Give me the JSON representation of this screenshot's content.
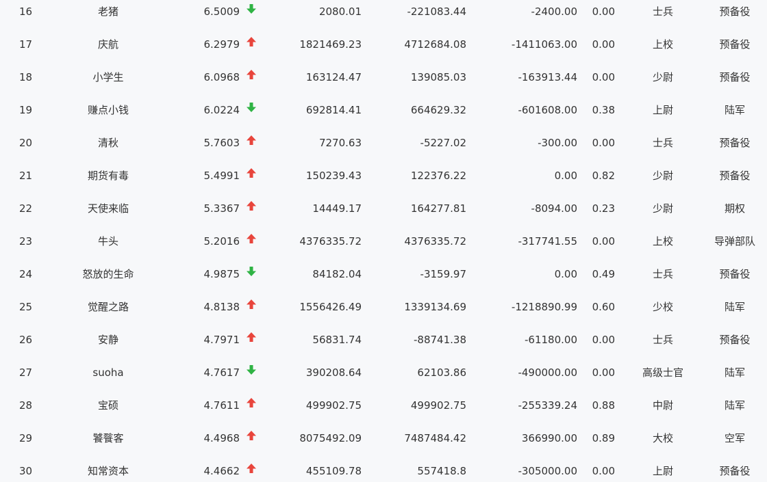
{
  "colors": {
    "background": "#f7f8fa",
    "text": "#333333",
    "up": "#e8453c",
    "down": "#2fb344"
  },
  "rows": [
    {
      "rank": "16",
      "name": "老猪",
      "score": "6.5009",
      "trend": "down",
      "v1": "2080.01",
      "v2": "-221083.44",
      "v3": "-2400.00",
      "v4": "0.00",
      "title": "士兵",
      "unit": "预备役"
    },
    {
      "rank": "17",
      "name": "庆航",
      "score": "6.2979",
      "trend": "up",
      "v1": "1821469.23",
      "v2": "4712684.08",
      "v3": "-1411063.00",
      "v4": "0.00",
      "title": "上校",
      "unit": "预备役"
    },
    {
      "rank": "18",
      "name": "小学生",
      "score": "6.0968",
      "trend": "up",
      "v1": "163124.47",
      "v2": "139085.03",
      "v3": "-163913.44",
      "v4": "0.00",
      "title": "少尉",
      "unit": "预备役"
    },
    {
      "rank": "19",
      "name": "赚点小钱",
      "score": "6.0224",
      "trend": "down",
      "v1": "692814.41",
      "v2": "664629.32",
      "v3": "-601608.00",
      "v4": "0.38",
      "title": "上尉",
      "unit": "陆军"
    },
    {
      "rank": "20",
      "name": "清秋",
      "score": "5.7603",
      "trend": "up",
      "v1": "7270.63",
      "v2": "-5227.02",
      "v3": "-300.00",
      "v4": "0.00",
      "title": "士兵",
      "unit": "预备役"
    },
    {
      "rank": "21",
      "name": "期货有毒",
      "score": "5.4991",
      "trend": "up",
      "v1": "150239.43",
      "v2": "122376.22",
      "v3": "0.00",
      "v4": "0.82",
      "title": "少尉",
      "unit": "预备役"
    },
    {
      "rank": "22",
      "name": "天使来临",
      "score": "5.3367",
      "trend": "up",
      "v1": "14449.17",
      "v2": "164277.81",
      "v3": "-8094.00",
      "v4": "0.23",
      "title": "少尉",
      "unit": "期权"
    },
    {
      "rank": "23",
      "name": "牛头",
      "score": "5.2016",
      "trend": "up",
      "v1": "4376335.72",
      "v2": "4376335.72",
      "v3": "-317741.55",
      "v4": "0.00",
      "title": "上校",
      "unit": "导弹部队"
    },
    {
      "rank": "24",
      "name": "怒放的生命",
      "score": "4.9875",
      "trend": "down",
      "v1": "84182.04",
      "v2": "-3159.97",
      "v3": "0.00",
      "v4": "0.49",
      "title": "士兵",
      "unit": "预备役"
    },
    {
      "rank": "25",
      "name": "觉醒之路",
      "score": "4.8138",
      "trend": "up",
      "v1": "1556426.49",
      "v2": "1339134.69",
      "v3": "-1218890.99",
      "v4": "0.60",
      "title": "少校",
      "unit": "陆军"
    },
    {
      "rank": "26",
      "name": "安静",
      "score": "4.7971",
      "trend": "up",
      "v1": "56831.74",
      "v2": "-88741.38",
      "v3": "-61180.00",
      "v4": "0.00",
      "title": "士兵",
      "unit": "预备役"
    },
    {
      "rank": "27",
      "name": "suoha",
      "score": "4.7617",
      "trend": "down",
      "v1": "390208.64",
      "v2": "62103.86",
      "v3": "-490000.00",
      "v4": "0.00",
      "title": "高级士官",
      "unit": "陆军"
    },
    {
      "rank": "28",
      "name": "宝硕",
      "score": "4.7611",
      "trend": "up",
      "v1": "499902.75",
      "v2": "499902.75",
      "v3": "-255339.24",
      "v4": "0.88",
      "title": "中尉",
      "unit": "陆军"
    },
    {
      "rank": "29",
      "name": "饕餮客",
      "score": "4.4968",
      "trend": "up",
      "v1": "8075492.09",
      "v2": "7487484.42",
      "v3": "366990.00",
      "v4": "0.89",
      "title": "大校",
      "unit": "空军"
    },
    {
      "rank": "30",
      "name": "知常资本",
      "score": "4.4662",
      "trend": "up",
      "v1": "455109.78",
      "v2": "557418.8",
      "v3": "-305000.00",
      "v4": "0.00",
      "title": "上尉",
      "unit": "预备役"
    }
  ]
}
